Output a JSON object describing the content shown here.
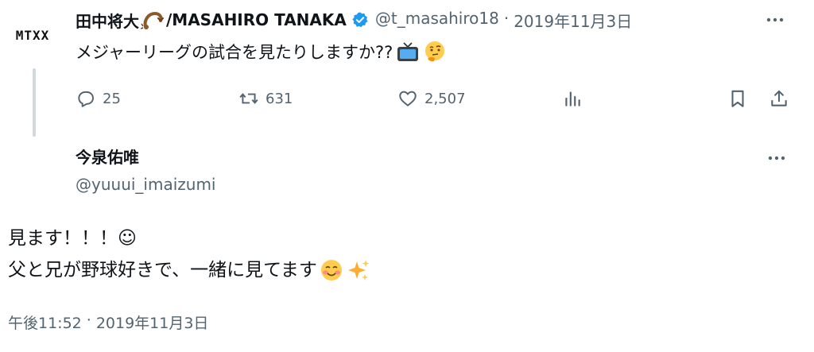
{
  "parent_tweet": {
    "avatar_text": "MTXX",
    "author_name_part1": "田中将大",
    "author_name_part2": "/MASAHIRO TANAKA",
    "handle": "@t_masahiro18",
    "separator": "·",
    "date": "2019年11月3日",
    "text": "メジャーリーグの試合を見たりしますか??",
    "emojis": [
      "tv-icon",
      "thinking-face-icon"
    ],
    "stats": {
      "replies": "25",
      "retweets": "631",
      "likes": "2,507"
    }
  },
  "reply_tweet": {
    "author_name": "今泉佑唯",
    "handle": "@yuuui_imaizumi",
    "line1": "見ます！！！☺︎",
    "line2": "父と兄が野球好きで、一緒に見てます",
    "emojis": [
      "smiling-blush-icon",
      "sparkles-icon"
    ],
    "time": "午後11:52",
    "separator": "·",
    "date": "2019年11月3日"
  },
  "colors": {
    "text": "#0f1419",
    "muted": "#536471",
    "verified": "#1d9bf0",
    "thread_line": "#cfd9de"
  }
}
